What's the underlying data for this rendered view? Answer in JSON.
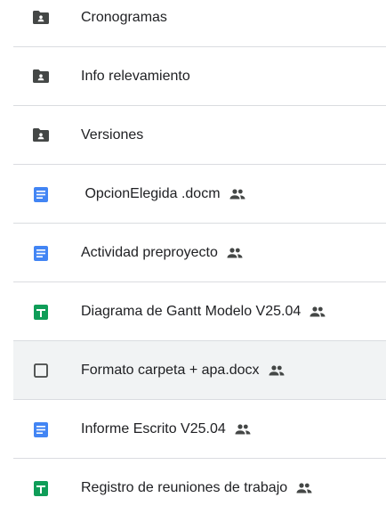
{
  "files": [
    {
      "name": "Cronogramas",
      "type": "shared-folder",
      "shared": false
    },
    {
      "name": "Info relevamiento",
      "type": "shared-folder",
      "shared": false
    },
    {
      "name": "Versiones",
      "type": "shared-folder",
      "shared": false
    },
    {
      "name": " OpcionElegida .docm",
      "type": "doc",
      "shared": true
    },
    {
      "name": "Actividad preproyecto",
      "type": "doc",
      "shared": true
    },
    {
      "name": "Diagrama de Gantt Modelo V25.04",
      "type": "sheet",
      "shared": true
    },
    {
      "name": "Formato carpeta + apa.docx",
      "type": "generic",
      "shared": true,
      "selected": true
    },
    {
      "name": "Informe Escrito V25.04",
      "type": "doc",
      "shared": true
    },
    {
      "name": "Registro de reuniones de trabajo",
      "type": "sheet",
      "shared": true
    }
  ],
  "colors": {
    "folder": "#444746",
    "doc": "#4285f4",
    "sheet": "#0f9d58",
    "text": "#202124",
    "divider": "#dadce0",
    "selected_bg": "#f1f3f4"
  },
  "icons": {
    "shared-folder": "shared-folder-icon",
    "doc": "google-docs-icon",
    "sheet": "google-sheets-icon",
    "generic": "generic-file-icon",
    "shared": "people-icon"
  }
}
